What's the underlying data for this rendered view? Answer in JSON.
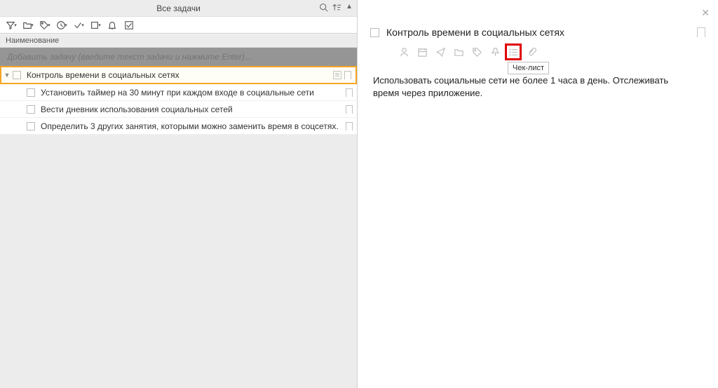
{
  "header": {
    "title": "Все задачи"
  },
  "columns": {
    "name": "Наименование"
  },
  "add_placeholder": "Добавить задачу (введите текст задачи и нажмите Enter)...",
  "tasks": {
    "main": "Контроль времени в социальных сетях",
    "sub": [
      "Установить таймер на 30 минут при каждом входе в социальные сети",
      "Вести дневник использования социальных сетей",
      "Определить 3 других занятия, которыми можно заменить время в соцсетях."
    ]
  },
  "detail": {
    "title": "Контроль времени в социальных сетях",
    "description": "Использовать социальные сети не более 1 часа в день. Отслеживать время через приложение.",
    "tooltip": "Чек-лист"
  }
}
